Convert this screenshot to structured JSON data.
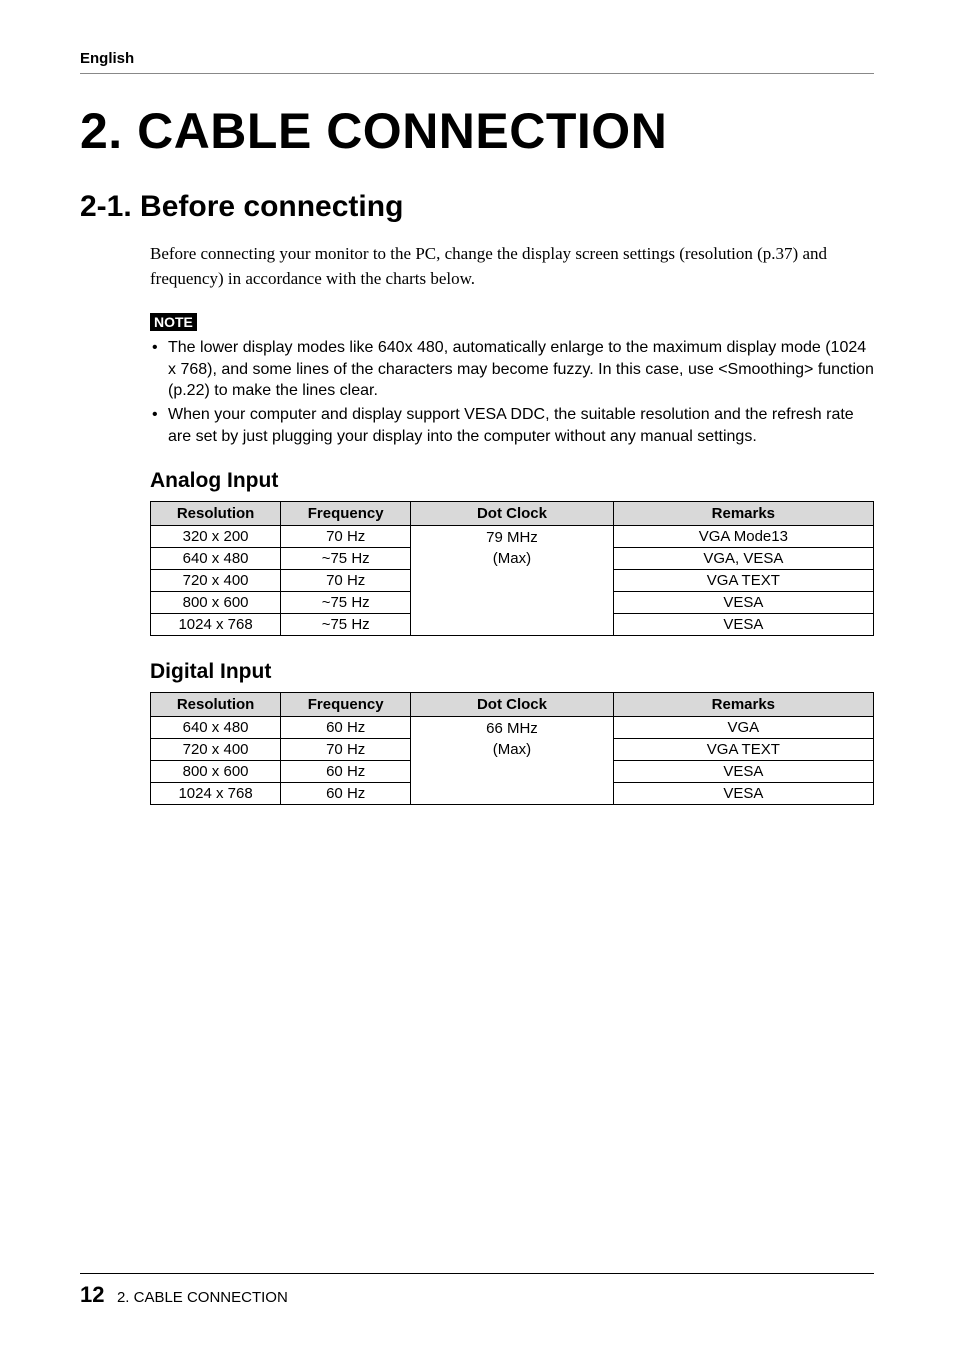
{
  "header_lang": "English",
  "h1": "2. CABLE CONNECTION",
  "h2": "2-1. Before connecting",
  "intro": "Before connecting your monitor to the PC, change the display screen settings (resolution (p.37) and frequency) in accordance with the charts below.",
  "note_label": "NOTE",
  "notes": [
    "The lower display modes like 640x 480, automatically enlarge to the maximum display mode (1024 x 768), and some lines of the characters may become fuzzy. In this case, use <Smoothing> function (p.22) to make the lines clear.",
    "When your computer and display support VESA DDC, the suitable resolution and the refresh rate are set by just plugging your display into the computer without any manual settings."
  ],
  "analog_heading": "Analog Input",
  "digital_heading": "Digital Input",
  "table_headers": {
    "resolution": "Resolution",
    "frequency": "Frequency",
    "dot_clock": "Dot Clock",
    "remarks": "Remarks"
  },
  "chart_data": [
    {
      "type": "table",
      "title": "Analog Input",
      "columns": [
        "Resolution",
        "Frequency",
        "Dot Clock",
        "Remarks"
      ],
      "dot_clock": [
        "79 MHz",
        "(Max)"
      ],
      "rows": [
        {
          "resolution": "320 x 200",
          "frequency": "70 Hz",
          "remarks": "VGA Mode13"
        },
        {
          "resolution": "640 x 480",
          "frequency": "~75 Hz",
          "remarks": "VGA, VESA"
        },
        {
          "resolution": "720 x 400",
          "frequency": "70 Hz",
          "remarks": "VGA TEXT"
        },
        {
          "resolution": "800 x 600",
          "frequency": "~75 Hz",
          "remarks": "VESA"
        },
        {
          "resolution": "1024 x 768",
          "frequency": "~75 Hz",
          "remarks": "VESA"
        }
      ]
    },
    {
      "type": "table",
      "title": "Digital Input",
      "columns": [
        "Resolution",
        "Frequency",
        "Dot Clock",
        "Remarks"
      ],
      "dot_clock": [
        "66 MHz",
        "(Max)"
      ],
      "rows": [
        {
          "resolution": "640 x 480",
          "frequency": "60 Hz",
          "remarks": "VGA"
        },
        {
          "resolution": "720 x 400",
          "frequency": "70 Hz",
          "remarks": "VGA TEXT"
        },
        {
          "resolution": "800 x 600",
          "frequency": "60 Hz",
          "remarks": "VESA"
        },
        {
          "resolution": "1024 x 768",
          "frequency": "60 Hz",
          "remarks": "VESA"
        }
      ]
    }
  ],
  "footer": {
    "page": "12",
    "text": "2. CABLE CONNECTION"
  }
}
